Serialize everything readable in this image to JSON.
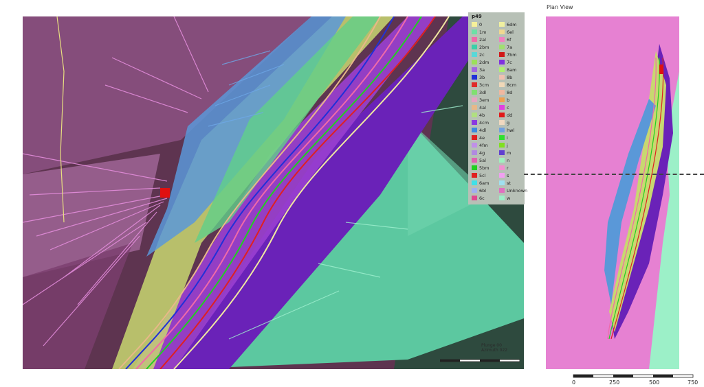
{
  "legend": {
    "title": "p49",
    "items": [
      {
        "label": "0",
        "color": "#f6f09a"
      },
      {
        "label": "1m",
        "color": "#6de0a6"
      },
      {
        "label": "2al",
        "color": "#f06aa8"
      },
      {
        "label": "2bm",
        "color": "#3ad0a8"
      },
      {
        "label": "2c",
        "color": "#58d8d8"
      },
      {
        "label": "2dm",
        "color": "#9ce05a"
      },
      {
        "label": "3a",
        "color": "#a066e0"
      },
      {
        "label": "3b",
        "color": "#2030d8"
      },
      {
        "label": "3cm",
        "color": "#e02a2a"
      },
      {
        "label": "3dl",
        "color": "#80e070"
      },
      {
        "label": "3em",
        "color": "#e6a6c0"
      },
      {
        "label": "4al",
        "color": "#e8b888"
      },
      {
        "label": "4b",
        "color": "#b0e080"
      },
      {
        "label": "4cm",
        "color": "#8a3ae0"
      },
      {
        "label": "4dl",
        "color": "#3a8ae0"
      },
      {
        "label": "4e",
        "color": "#e02020"
      },
      {
        "label": "4fm",
        "color": "#c090e8"
      },
      {
        "label": "4g",
        "color": "#b08ae0"
      },
      {
        "label": "5al",
        "color": "#e060b0"
      },
      {
        "label": "5bm",
        "color": "#20d020"
      },
      {
        "label": "5cl",
        "color": "#e02020"
      },
      {
        "label": "6am",
        "color": "#40e0e8"
      },
      {
        "label": "6bl",
        "color": "#a0b0f0"
      },
      {
        "label": "6c",
        "color": "#e04890"
      },
      {
        "label": "6dm",
        "color": "#f0f0a0"
      },
      {
        "label": "6el",
        "color": "#f0d890"
      },
      {
        "label": "6f",
        "color": "#f080c0"
      },
      {
        "label": "7a",
        "color": "#a0e070"
      },
      {
        "label": "7bm",
        "color": "#d01818"
      },
      {
        "label": "7c",
        "color": "#8030e0"
      },
      {
        "label": "8am",
        "color": "#b0f070"
      },
      {
        "label": "8b",
        "color": "#f0c0b0"
      },
      {
        "label": "8cm",
        "color": "#f0d8b8"
      },
      {
        "label": "8d",
        "color": "#f0b8a0"
      },
      {
        "label": "b",
        "color": "#f0a050"
      },
      {
        "label": "c",
        "color": "#e040e0"
      },
      {
        "label": "dd",
        "color": "#e01818"
      },
      {
        "label": "g",
        "color": "#f0d8c0"
      },
      {
        "label": "hwl",
        "color": "#70a0e0"
      },
      {
        "label": "i",
        "color": "#30e030"
      },
      {
        "label": "j",
        "color": "#80e020"
      },
      {
        "label": "m",
        "color": "#6040d0"
      },
      {
        "label": "n",
        "color": "#a0f0c0"
      },
      {
        "label": "r",
        "color": "#f090d0"
      },
      {
        "label": "s",
        "color": "#f0a0f0"
      },
      {
        "label": "st",
        "color": "#a0e0f0"
      },
      {
        "label": "Unknown",
        "color": "#e070c0"
      },
      {
        "label": "w",
        "color": "#9cf0c8"
      }
    ]
  },
  "view_info": {
    "plunge": "Plunge 00",
    "azimuth": "Azimuth 022"
  },
  "plan_view": {
    "title": "Plan View"
  },
  "scalebar": {
    "ticks": [
      "0",
      "250",
      "500",
      "750"
    ]
  },
  "colors": {
    "pink": "#e681d2",
    "teal": "#5cc8a0",
    "purple": "#6a22b8",
    "host": "#5e3450"
  }
}
